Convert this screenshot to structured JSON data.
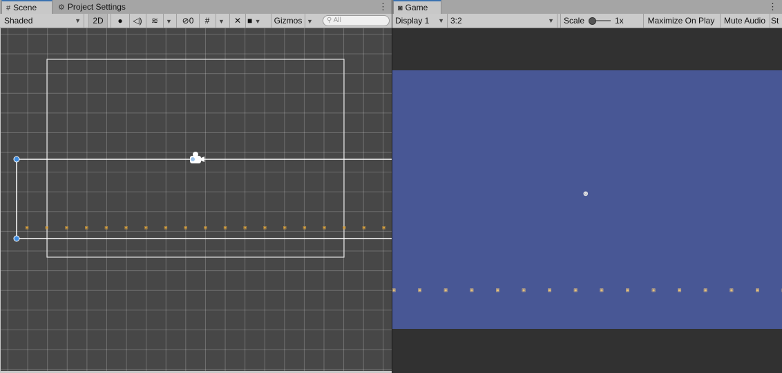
{
  "scene": {
    "tabs": [
      {
        "label": "Scene",
        "icon": "grid-icon"
      },
      {
        "label": "Project Settings",
        "icon": "gear-icon"
      }
    ],
    "toolbar": {
      "shading_mode": "Shaded",
      "mode_2d": "2D",
      "hidden_count": "0",
      "gizmos": "Gizmos",
      "search_placeholder": "All"
    }
  },
  "game": {
    "tab": {
      "label": "Game",
      "icon": "gamepad-icon"
    },
    "toolbar": {
      "display": "Display 1",
      "aspect": "3:2",
      "scale_label": "Scale",
      "scale_value": "1x",
      "maximize": "Maximize On Play",
      "mute": "Mute Audio",
      "stats": "St"
    }
  },
  "colors": {
    "game_background": "#485795",
    "scene_background": "#474747",
    "selection_blue": "#3a72b0"
  },
  "glyphs": {
    "crate": "▣",
    "character": "☻",
    "camera": "◉",
    "kebab": "⋮",
    "dropdown": "▼"
  }
}
